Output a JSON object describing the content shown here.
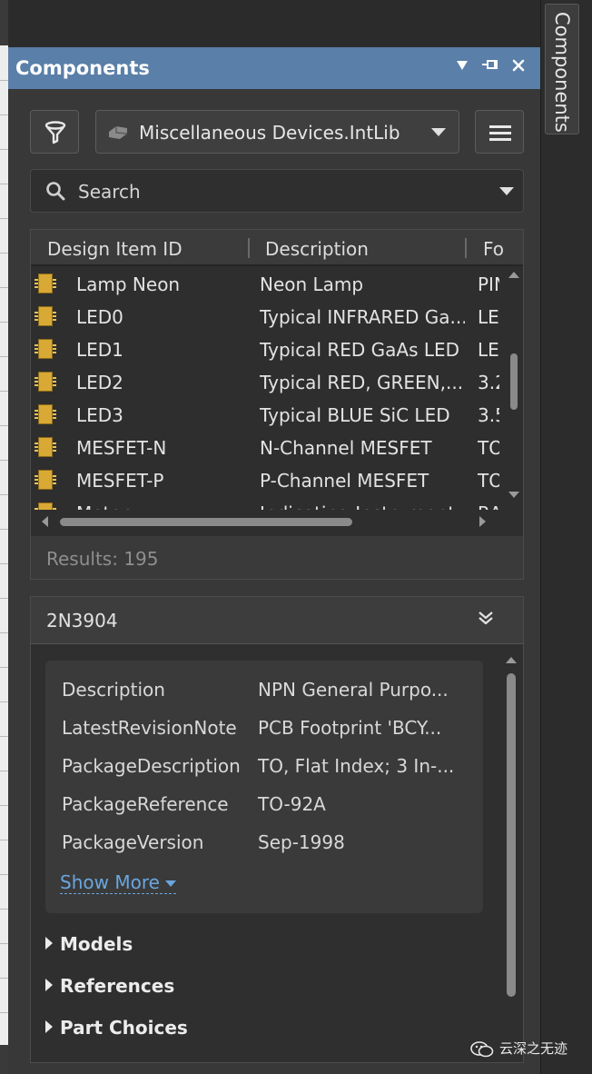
{
  "panel": {
    "title": "Components",
    "vertical_tab": "Components"
  },
  "toolbar": {
    "library": "Miscellaneous Devices.IntLib",
    "search_placeholder": "Search"
  },
  "grid": {
    "columns": [
      "Design Item ID",
      "Description",
      "Fo"
    ],
    "rows": [
      {
        "id": "Lamp Neon",
        "desc": "Neon Lamp",
        "fp": "PIN"
      },
      {
        "id": "LED0",
        "desc": "Typical INFRARED Ga...",
        "fp": "LED"
      },
      {
        "id": "LED1",
        "desc": "Typical RED GaAs LED",
        "fp": "LED"
      },
      {
        "id": "LED2",
        "desc": "Typical RED, GREEN,...",
        "fp": "3.2"
      },
      {
        "id": "LED3",
        "desc": "Typical BLUE SiC LED",
        "fp": "3.5"
      },
      {
        "id": "MESFET-N",
        "desc": "N-Channel MESFET",
        "fp": "TO"
      },
      {
        "id": "MESFET-P",
        "desc": "P-Channel MESFET",
        "fp": "TO"
      },
      {
        "id": "Meter",
        "desc": "Indicating Instrument",
        "fp": "RA"
      }
    ],
    "results": "Results: 195"
  },
  "detail": {
    "name": "2N3904",
    "properties": [
      {
        "key": "Description",
        "value": "NPN General Purpo..."
      },
      {
        "key": "LatestRevisionNote",
        "value": "PCB Footprint 'BCY..."
      },
      {
        "key": "PackageDescription",
        "value": "TO, Flat Index; 3 In-..."
      },
      {
        "key": "PackageReference",
        "value": "TO-92A"
      },
      {
        "key": "PackageVersion",
        "value": "Sep-1998"
      }
    ],
    "show_more": "Show More",
    "sections": [
      "Models",
      "References",
      "Part Choices"
    ]
  },
  "watermark": "云深之无迹",
  "colors": {
    "title_bar": "#5a7fa8",
    "link": "#6aa6de",
    "panel_bg": "#383838",
    "component_icon": "#d9a936"
  }
}
